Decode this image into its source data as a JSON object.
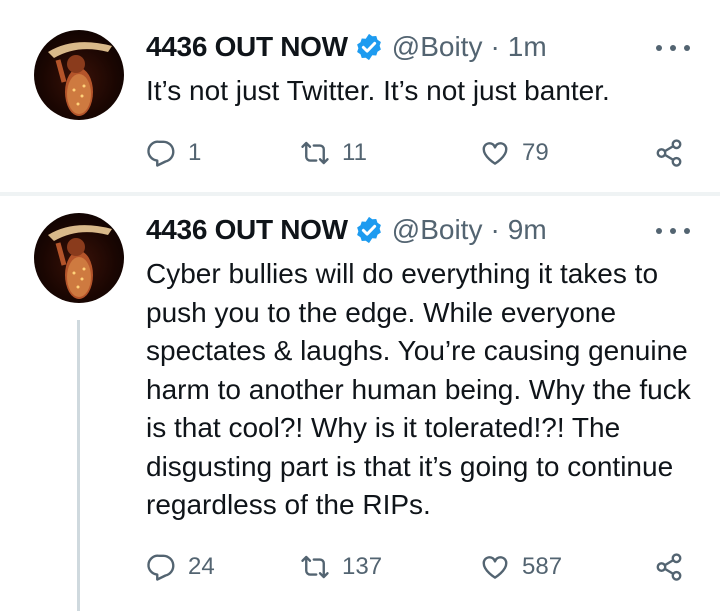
{
  "tweets": [
    {
      "display_name": "4436 OUT NOW",
      "handle": "@Boity",
      "separator": "·",
      "time": "1m",
      "text": "It’s not just Twitter. It’s not just banter.",
      "replies": "1",
      "retweets": "11",
      "likes": "79"
    },
    {
      "display_name": "4436 OUT NOW",
      "handle": "@Boity",
      "separator": "·",
      "time": "9m",
      "text": "Cyber bullies will do everything it takes to push you to the edge. While everyone spectates & laughs. You’re causing genuine harm to another human being. Why the fuck is that cool?! Why is it tolerated!?! The disgusting part is that it’s going to continue regardless of the RIPs.",
      "replies": "24",
      "retweets": "137",
      "likes": "587"
    }
  ],
  "icons": {
    "verified": "verified-badge-icon",
    "more": "more-dots-icon",
    "reply": "reply-icon",
    "retweet": "retweet-icon",
    "like": "heart-icon",
    "share": "share-icon"
  },
  "colors": {
    "verified_blue": "#1d9bf0",
    "secondary_text": "#536471",
    "primary_text": "#0f1419",
    "thread_line": "#cfd9de",
    "divider": "#eff3f4"
  }
}
